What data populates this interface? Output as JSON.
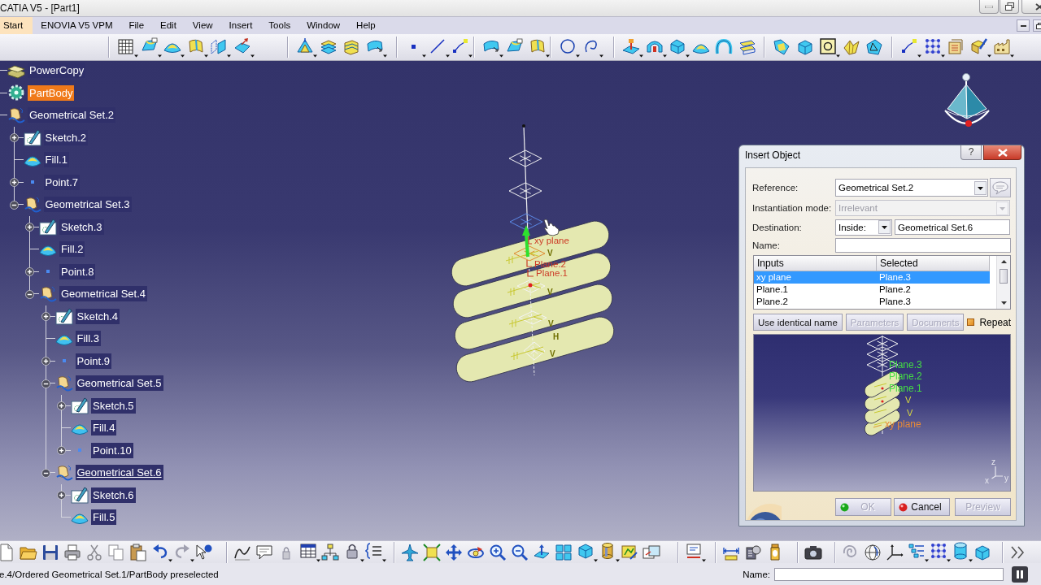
{
  "window": {
    "title": "CATIA V5 - [Part1]"
  },
  "menu": [
    {
      "label": "Start",
      "selected": true
    },
    {
      "label": "ENOVIA V5 VPM",
      "selected": false
    },
    {
      "label": "File",
      "selected": false
    },
    {
      "label": "Edit",
      "selected": false
    },
    {
      "label": "View",
      "selected": false
    },
    {
      "label": "Insert",
      "selected": false
    },
    {
      "label": "Tools",
      "selected": false
    },
    {
      "label": "Window",
      "selected": false
    },
    {
      "label": "Help",
      "selected": false
    }
  ],
  "tree": {
    "items": [
      {
        "label": "PowerCopy",
        "kind": "powercopy",
        "selected": false,
        "current": false
      },
      {
        "label": "PartBody",
        "kind": "body",
        "selected": true,
        "current": false
      },
      {
        "label": "Geometrical Set.2",
        "kind": "geoset",
        "selected": false,
        "current": false,
        "children": [
          {
            "label": "Sketch.2",
            "kind": "sketch",
            "selected": false,
            "current": false,
            "expanded": false
          },
          {
            "label": "Fill.1",
            "kind": "fill",
            "selected": false,
            "current": false
          },
          {
            "label": "Point.7",
            "kind": "point",
            "selected": false,
            "current": false,
            "expanded": false
          },
          {
            "label": "Geometrical Set.3",
            "kind": "geoset",
            "selected": false,
            "current": false,
            "expanded": true,
            "children": [
              {
                "label": "Sketch.3",
                "kind": "sketch",
                "selected": false,
                "current": false,
                "expanded": false
              },
              {
                "label": "Fill.2",
                "kind": "fill",
                "selected": false,
                "current": false
              },
              {
                "label": "Point.8",
                "kind": "point",
                "selected": false,
                "current": false,
                "expanded": false
              },
              {
                "label": "Geometrical Set.4",
                "kind": "geoset",
                "selected": false,
                "current": false,
                "expanded": true,
                "children": [
                  {
                    "label": "Sketch.4",
                    "kind": "sketch",
                    "selected": false,
                    "current": false,
                    "expanded": false
                  },
                  {
                    "label": "Fill.3",
                    "kind": "fill",
                    "selected": false,
                    "current": false
                  },
                  {
                    "label": "Point.9",
                    "kind": "point",
                    "selected": false,
                    "current": false,
                    "expanded": false
                  },
                  {
                    "label": "Geometrical Set.5",
                    "kind": "geoset",
                    "selected": false,
                    "current": false,
                    "expanded": true,
                    "children": [
                      {
                        "label": "Sketch.5",
                        "kind": "sketch",
                        "selected": false,
                        "current": false,
                        "expanded": false
                      },
                      {
                        "label": "Fill.4",
                        "kind": "fill",
                        "selected": false,
                        "current": false
                      },
                      {
                        "label": "Point.10",
                        "kind": "point",
                        "selected": false,
                        "current": false,
                        "expanded": false
                      }
                    ]
                  },
                  {
                    "label": "Geometrical Set.6",
                    "kind": "geoset",
                    "selected": false,
                    "current": true,
                    "expanded": true,
                    "children": [
                      {
                        "label": "Sketch.6",
                        "kind": "sketch",
                        "selected": false,
                        "current": false,
                        "expanded": false
                      },
                      {
                        "label": "Fill.5",
                        "kind": "fill",
                        "selected": false,
                        "current": false
                      }
                    ]
                  }
                ]
              }
            ]
          }
        ]
      }
    ]
  },
  "viewport": {
    "model": {
      "labels": [
        "xy plane",
        "Plane.2",
        "Plane.1"
      ],
      "axis_letters": [
        "V",
        "V",
        "V",
        "H",
        "V"
      ]
    }
  },
  "dialog": {
    "title": "Insert Object",
    "help": "?",
    "reference": {
      "label": "Reference:",
      "value": "Geometrical Set.2",
      "disabled": false
    },
    "instantiation_mode": {
      "label": "Instantiation mode:",
      "value": "Irrelevant",
      "disabled": true
    },
    "destination": {
      "label": "Destination:",
      "mode": "Inside:",
      "value": "Geometrical Set.6"
    },
    "name": {
      "label": "Name:"
    },
    "table": {
      "columns": [
        "Inputs",
        "Selected"
      ],
      "rows": [
        {
          "cells": [
            "xy plane",
            "Plane.3"
          ],
          "selected": true
        },
        {
          "cells": [
            "Plane.1",
            "Plane.2"
          ],
          "selected": false
        },
        {
          "cells": [
            "Plane.2",
            "Plane.3"
          ],
          "selected": false
        }
      ]
    },
    "options": [
      {
        "label": "Use identical name",
        "disabled": false
      },
      {
        "label": "Parameters",
        "disabled": true
      },
      {
        "label": "Documents",
        "disabled": true
      }
    ],
    "repeat": {
      "label": "Repeat",
      "checked": true
    },
    "preview": {
      "labels": [
        {
          "text": "Plane.3",
          "kind": "plane"
        },
        {
          "text": "Plane.2",
          "kind": "plane"
        },
        {
          "text": "Plane.1",
          "kind": "plane"
        },
        {
          "text": "V",
          "kind": "axis"
        },
        {
          "text": "V",
          "kind": "axis"
        },
        {
          "text": "xy plane",
          "kind": "reference"
        }
      ],
      "axis_letters": [
        "z",
        "x",
        "y"
      ]
    },
    "actions": [
      {
        "label": "OK",
        "kind": "ok",
        "disabled": true
      },
      {
        "label": "Cancel",
        "kind": "cancel",
        "disabled": false
      },
      {
        "label": "Preview",
        "kind": "preview",
        "disabled": true
      }
    ]
  },
  "status_bar": {
    "message": "e.4/Ordered Geometrical Set.1/PartBody preselected",
    "name_label": "Name:"
  }
}
